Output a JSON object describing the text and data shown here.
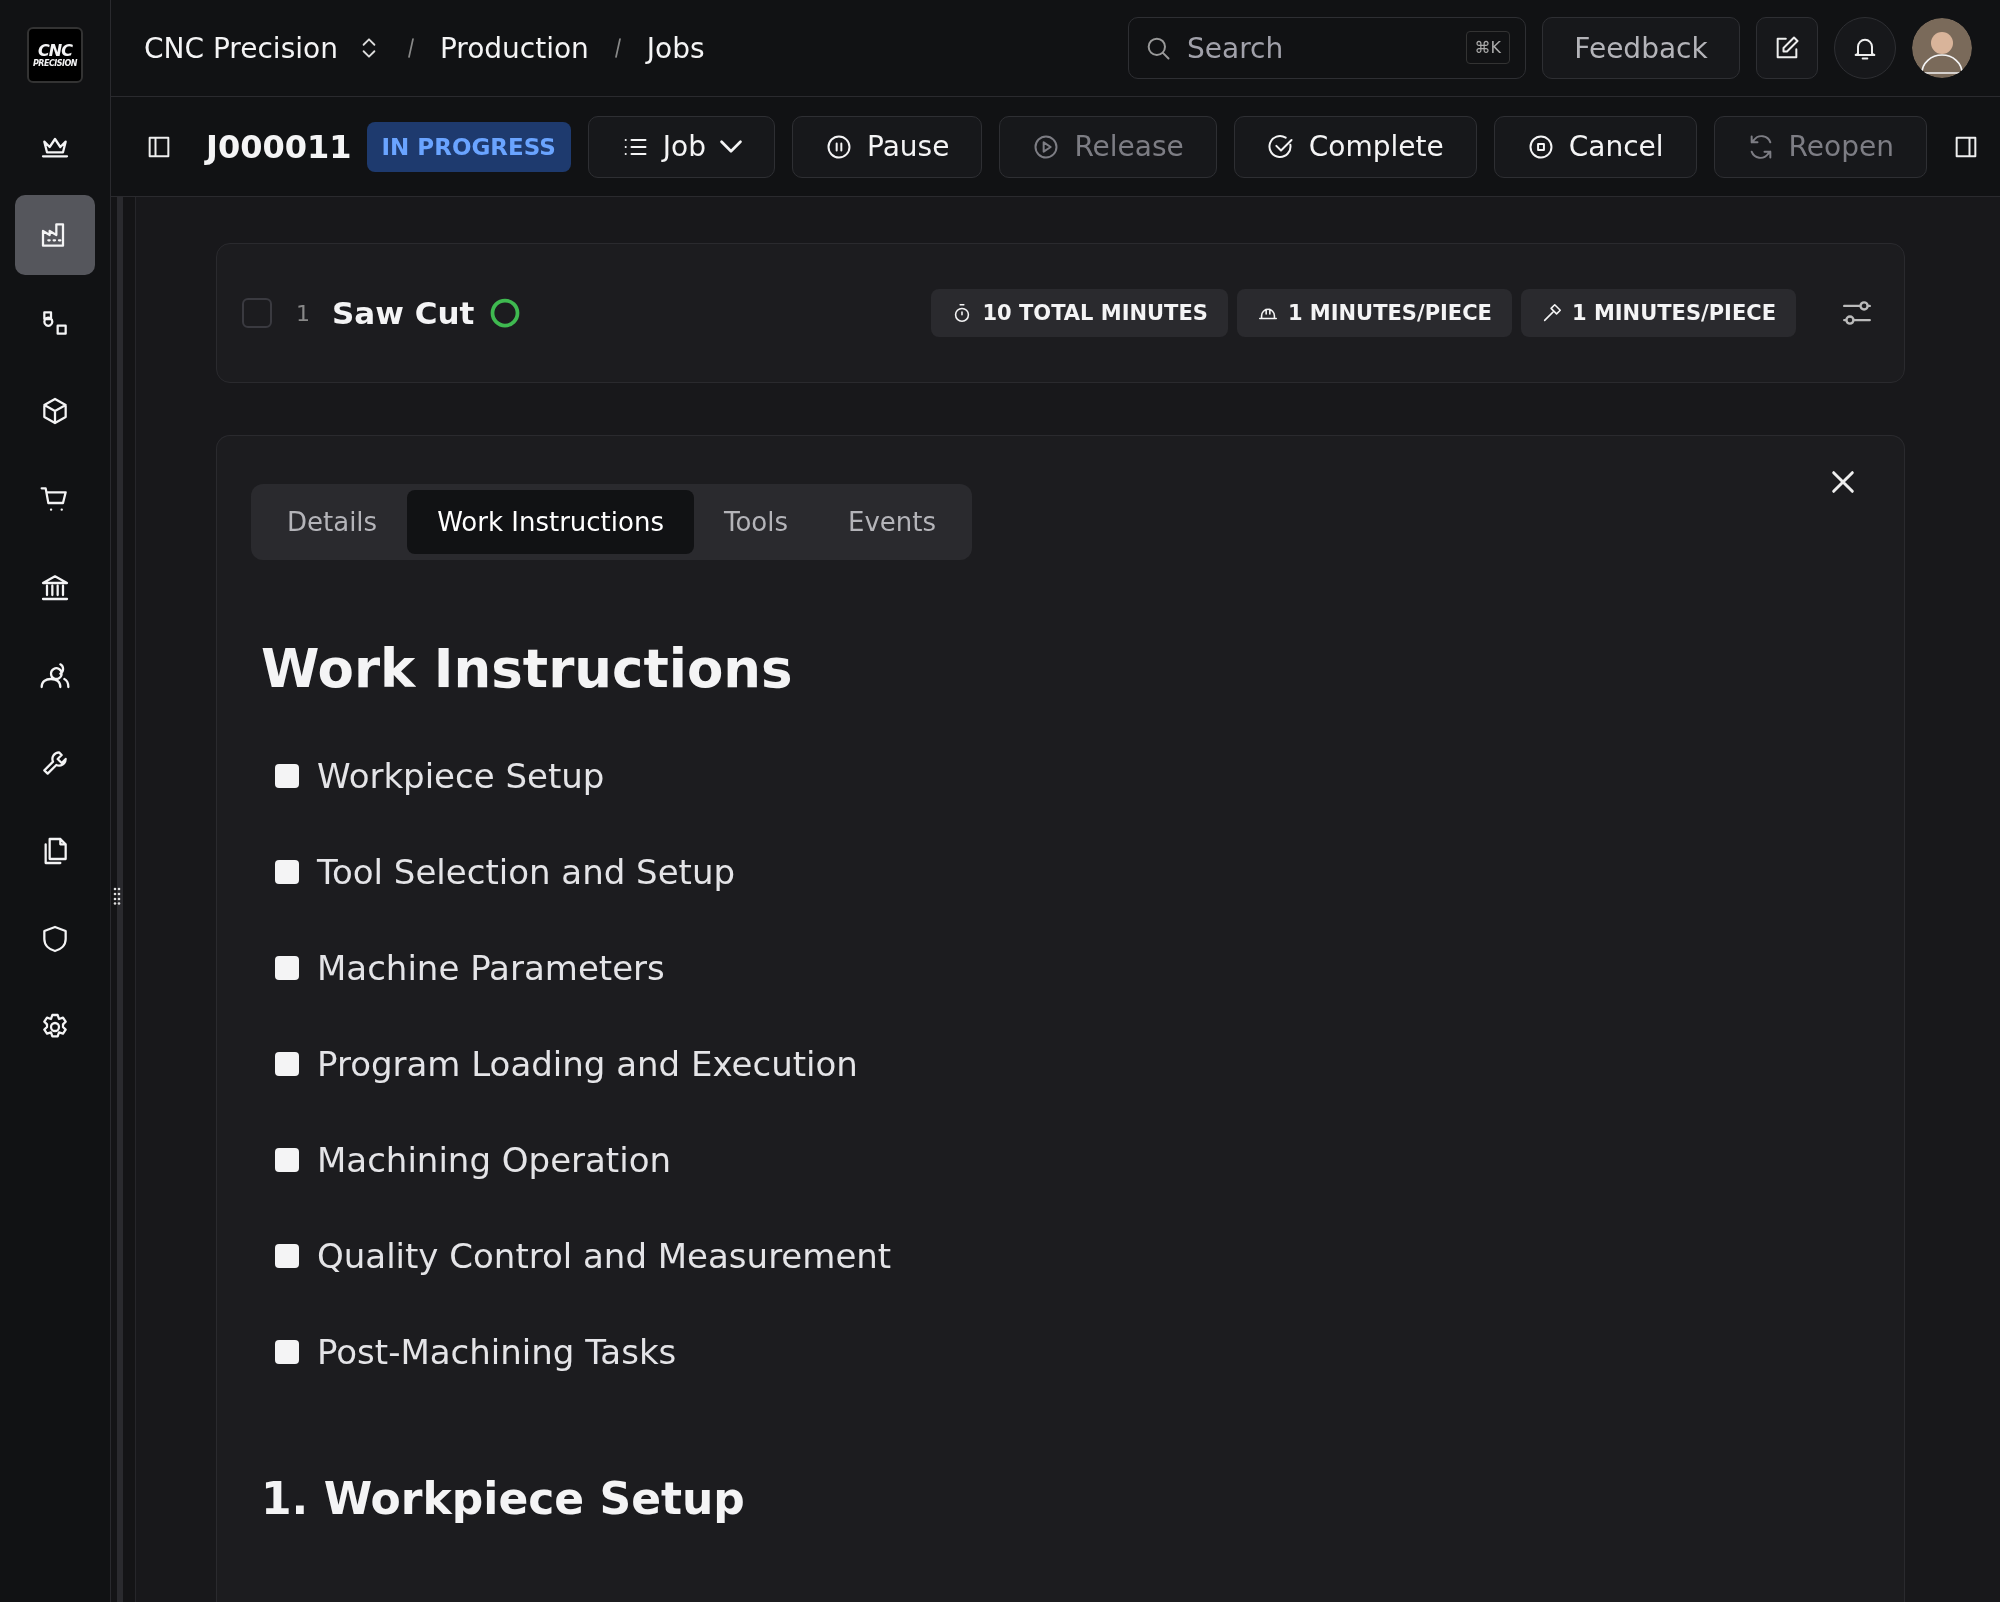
{
  "sidebar": {
    "logo": {
      "line_1": "CNC",
      "line_2": "PRECISION"
    },
    "items": [
      {
        "selected": false
      },
      {
        "selected": true
      },
      {
        "selected": false
      },
      {
        "selected": false
      },
      {
        "selected": false
      },
      {
        "selected": false
      },
      {
        "selected": false
      },
      {
        "selected": false
      },
      {
        "selected": false
      },
      {
        "selected": false
      },
      {
        "selected": false
      }
    ]
  },
  "breadcrumbs": [
    "CNC Precision",
    "Production",
    "Jobs"
  ],
  "search": {
    "placeholder": "Search",
    "shortcut": "⌘K"
  },
  "feedback_button": "Feedback",
  "job": {
    "id": "J000011",
    "status": "IN PROGRESS",
    "view_menu": "Job"
  },
  "actions": [
    {
      "label": "Pause",
      "disabled": false
    },
    {
      "label": "Release",
      "disabled": true
    },
    {
      "label": "Complete",
      "disabled": false
    },
    {
      "label": "Cancel",
      "disabled": false
    },
    {
      "label": "Reopen",
      "disabled": true
    }
  ],
  "operation": {
    "checked": false,
    "number": "1",
    "name": "Saw Cut",
    "badges": [
      "10 TOTAL MINUTES",
      "1 MINUTES/PIECE",
      "1 MINUTES/PIECE"
    ]
  },
  "tabs": [
    {
      "label": "Details",
      "selected": false
    },
    {
      "label": "Work Instructions",
      "selected": true
    },
    {
      "label": "Tools",
      "selected": false
    },
    {
      "label": "Events",
      "selected": false
    }
  ],
  "heading": "Work Instructions",
  "checklist": [
    {
      "label": "Workpiece Setup",
      "checked": false
    },
    {
      "label": "Tool Selection and Setup",
      "checked": false
    },
    {
      "label": "Machine Parameters",
      "checked": false
    },
    {
      "label": "Program Loading and Execution",
      "checked": false
    },
    {
      "label": "Machining Operation",
      "checked": false
    },
    {
      "label": "Quality Control and Measurement",
      "checked": false
    },
    {
      "label": "Post-Machining Tasks",
      "checked": false
    }
  ],
  "section_heading": "1. Workpiece Setup"
}
